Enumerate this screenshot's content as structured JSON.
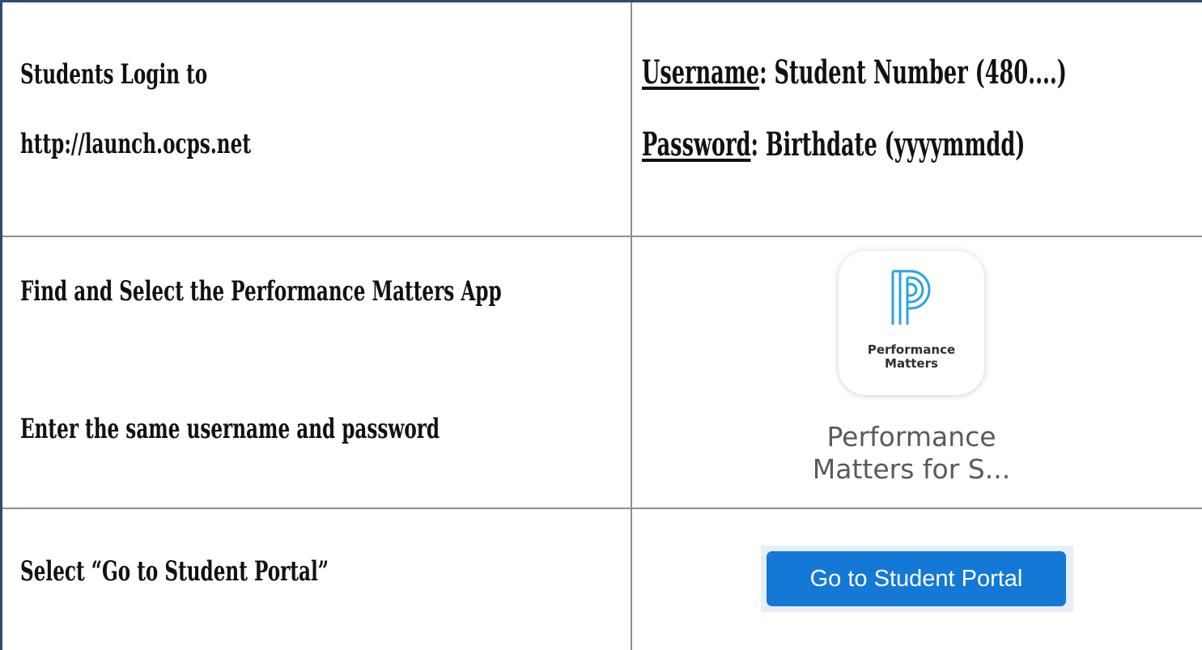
{
  "rows": [
    {
      "left": [
        "Students Login to",
        "http://launch.ocps.net"
      ],
      "right": {
        "username_label": "Username",
        "username_value": ": Student Number (480....)",
        "password_label": "Password",
        "password_value": ": Birthdate (yyyymmdd)"
      }
    },
    {
      "left": [
        "Find and Select the Performance Matters App",
        "Enter the same username and password"
      ],
      "right": {
        "app_icon_brand": [
          "Performance",
          "Matters"
        ],
        "app_caption": [
          "Performance",
          "Matters for S..."
        ],
        "icon_name": "performance-matters-logo-icon",
        "icon_color": "#2aa6d9"
      }
    },
    {
      "left": [
        "Select “Go to Student Portal”"
      ],
      "right": {
        "button_label": "Go to Student Portal",
        "button_color": "#1478d6"
      }
    }
  ]
}
